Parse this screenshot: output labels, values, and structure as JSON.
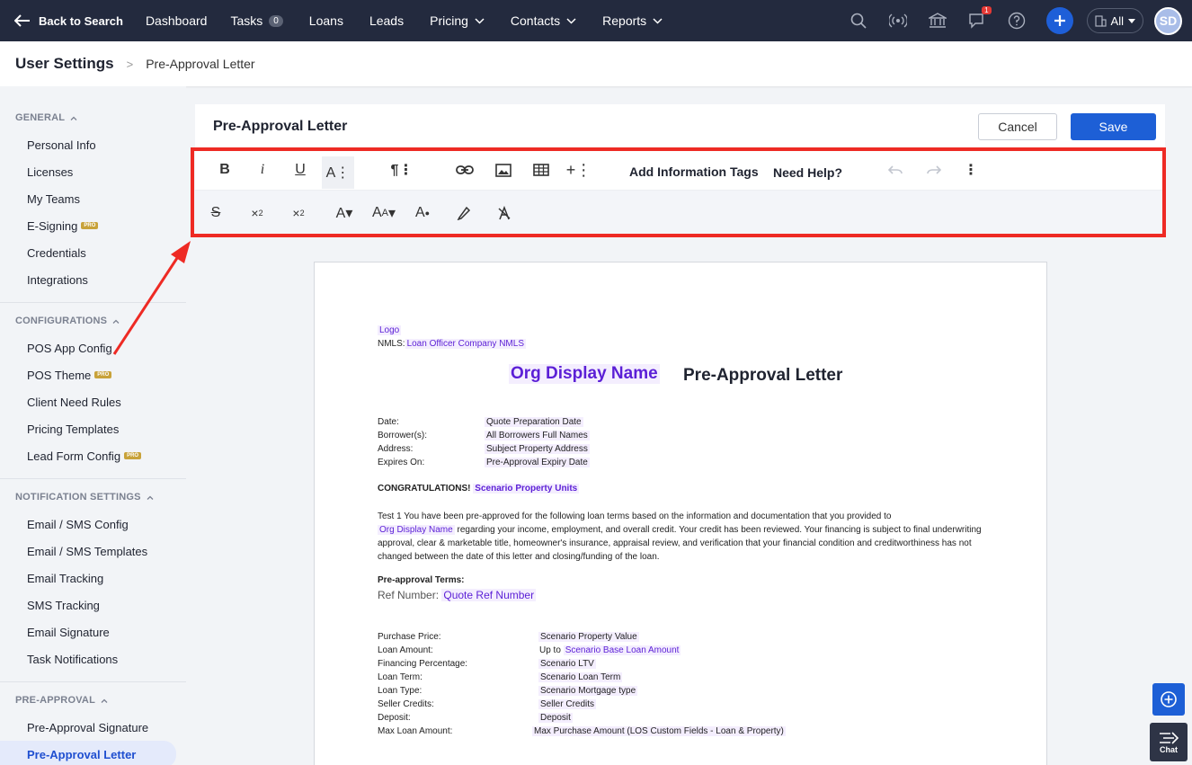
{
  "nav": {
    "back_label": "Back to Search",
    "items": [
      {
        "label": "Dashboard"
      },
      {
        "label": "Tasks",
        "count": "0"
      },
      {
        "label": "Loans"
      },
      {
        "label": "Leads"
      },
      {
        "label": "Pricing",
        "dropdown": true
      },
      {
        "label": "Contacts",
        "dropdown": true
      },
      {
        "label": "Reports",
        "dropdown": true
      }
    ],
    "notification_count": "1",
    "scope_label": "All",
    "avatar_initials": "SD"
  },
  "breadcrumb": {
    "parent": "User Settings",
    "current": "Pre-Approval Letter"
  },
  "sidebar": {
    "sections": [
      {
        "title": "GENERAL",
        "items": [
          "Personal Info",
          "Licenses",
          "My Teams",
          "E-Signing",
          "Credentials",
          "Integrations"
        ]
      },
      {
        "title": "CONFIGURATIONS",
        "items": [
          "POS App Config",
          "POS Theme",
          "Client Need Rules",
          "Pricing Templates",
          "Lead Form Config"
        ]
      },
      {
        "title": "NOTIFICATION SETTINGS",
        "items": [
          "Email / SMS Config",
          "Email / SMS Templates",
          "Email Tracking",
          "SMS Tracking",
          "Email Signature",
          "Task Notifications"
        ]
      },
      {
        "title": "PRE-APPROVAL",
        "items": [
          "Pre-Approval Signature",
          "Pre-Approval Letter"
        ]
      }
    ],
    "pro_label": "PRO",
    "active_item": "Pre-Approval Letter"
  },
  "editor": {
    "title": "Pre-Approval Letter",
    "cancel_label": "Cancel",
    "save_label": "Save",
    "add_tags_label": "Add Information Tags",
    "help_label": "Need Help?"
  },
  "letter": {
    "logo_tag": "Logo",
    "nmls_label": "NMLS:",
    "nmls_tag": "Loan Officer Company NMLS",
    "org_name_tag": "Org Display Name",
    "heading": "Pre-Approval Letter",
    "fields": [
      {
        "label": "Date:",
        "tag": "Quote Preparation Date"
      },
      {
        "label": "Borrower(s):",
        "tag": "All Borrowers Full Names"
      },
      {
        "label": "Address:",
        "tag": "Subject Property Address"
      },
      {
        "label": "Expires On:",
        "tag": "Pre-Approval Expiry Date"
      }
    ],
    "congrats": "CONGRATULATIONS!",
    "congrats_tag": "Scenario Property Units",
    "body_line1": "Test 1 You have been pre-approved for the following loan terms based on the information and  documentation that you provided to",
    "body_org_tag": "Org Display Name",
    "body_rest": " regarding your income, employment, and overall credit. Your credit has  been reviewed. Your financing is subject to final underwriting approval, clear & marketable title, homeowner's  insurance, appraisal review, and verification that your financial condition and creditworthiness has not changed  between the date of this letter and closing/funding of the loan.",
    "terms_heading": "Pre-approval Terms:",
    "ref_label": "Ref Number:",
    "ref_tag": "Quote Ref Number",
    "terms": [
      {
        "label": "Purchase Price:",
        "prefix": "",
        "tag": "Scenario Property Value"
      },
      {
        "label": "Loan Amount:",
        "prefix": "Up to ",
        "tag": "Scenario Base Loan Amount"
      },
      {
        "label": "Financing Percentage:",
        "prefix": "",
        "tag": "Scenario LTV"
      },
      {
        "label": "Loan Term:",
        "prefix": "",
        "tag": "Scenario Loan Term"
      },
      {
        "label": "Loan Type:",
        "prefix": "",
        "tag": "Scenario Mortgage type"
      },
      {
        "label": "Seller Credits:",
        "prefix": "",
        "tag": "Seller Credits"
      },
      {
        "label": "Deposit:",
        "prefix": "",
        "tag": "Deposit"
      },
      {
        "label": "Max Loan Amount:",
        "prefix": "",
        "tag": "Max Purchase Amount (LOS Custom Fields - Loan & Property)"
      }
    ]
  },
  "chat_label": "Chat",
  "colors": {
    "nav_bg": "#232a3e",
    "accent": "#1d5fd6",
    "tag_text": "#5b1fd6",
    "tag_bg": "#f4eefe",
    "highlight_box": "#ee2a24"
  }
}
